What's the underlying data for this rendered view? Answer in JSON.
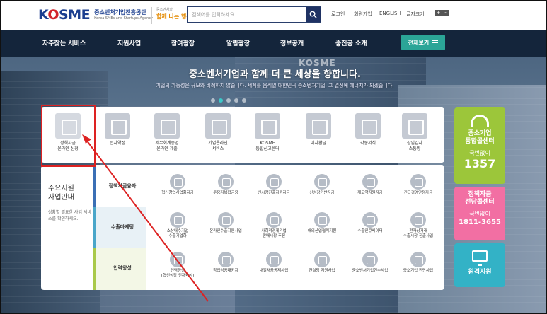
{
  "header": {
    "logo_mark": "KOSME",
    "logo_kor": "중소벤처기업진흥공단",
    "logo_eng": "Korea SMEs and Startups Agency",
    "slogan_small": "중소벤처와",
    "slogan_big": "함께 나는 행복",
    "search_placeholder": "검색어를 입력하세요.",
    "login": "로그인",
    "join": "회원가입",
    "english": "ENGLISH",
    "font_size": "글자크기",
    "font_plus": "+",
    "font_minus": "-"
  },
  "nav": {
    "items": [
      "자주찾는 서비스",
      "지원사업",
      "참여광장",
      "알림광장",
      "정보공개",
      "중진공 소개"
    ],
    "all": "전체보기"
  },
  "hero": {
    "sign": "KOSME",
    "title": "중소벤처기업과 함께 더 큰 세상을 향합니다.",
    "subtitle": "기업의 가능성은 규모와 비례하지 않습니다. 세계를 움직일 대한민국 중소벤처기업, 그 열정에 에너지가 되겠습니다."
  },
  "quick": [
    {
      "label": "정책자금\n온라인 신청",
      "icon": "mouse-icon"
    },
    {
      "label": "전자약정",
      "icon": "monitor-icon"
    },
    {
      "label": "세무회계증명\n온라인 제출",
      "icon": "document-icon"
    },
    {
      "label": "기업온라인\n서비스",
      "icon": "building-icon"
    },
    {
      "label": "KOSME\n통합신고센터",
      "icon": "bell-icon"
    },
    {
      "label": "이자환급",
      "icon": "money-icon"
    },
    {
      "label": "각종서식",
      "icon": "folder-icon"
    },
    {
      "label": "상임감사\n소통방",
      "icon": "chat-icon"
    }
  ],
  "side": {
    "call_title": "중소기업\n통합콜센터",
    "call_sub": "국번없이",
    "call_num": "1357",
    "policy_title": "정책자금\n전담콜센터",
    "policy_sub": "국번없이",
    "policy_num": "1811-3655",
    "remote": "원격지원"
  },
  "main": {
    "title": "주요지원\n사업안내",
    "desc": "상황별 필요한 사업 서비스를 확인하세요.",
    "rows": [
      {
        "category": "정책자금융자",
        "items": [
          "혁신창업사업화자금",
          "투융자복합금융",
          "신시장진출지원자금",
          "신성장기반자금",
          "재도약지원자금",
          "긴급경영안정자금"
        ]
      },
      {
        "category": "수출마케팅",
        "items": [
          "소상내수기업\n수출기업화",
          "온라인수출지원사업",
          "사회적경제기업\n판매시장 추진",
          "해외산업협력지원",
          "수출인큐베이터",
          "전자상거래\n수출시장 진출사업"
        ]
      },
      {
        "category": "인력양성",
        "items": [
          "인력양성\n(혁신성장 인재육성)",
          "창업성공패키지",
          "내일채움공제사업",
          "컨설팅 지원사업",
          "중소벤처기업연수사업",
          "중소기업 진단사업"
        ]
      }
    ]
  },
  "colors": {
    "navy": "#14253b",
    "teal": "#2ba597",
    "green": "#9cc63a",
    "pink": "#f26fa3",
    "cyan": "#33b2c6",
    "annotation": "#dd2222"
  }
}
